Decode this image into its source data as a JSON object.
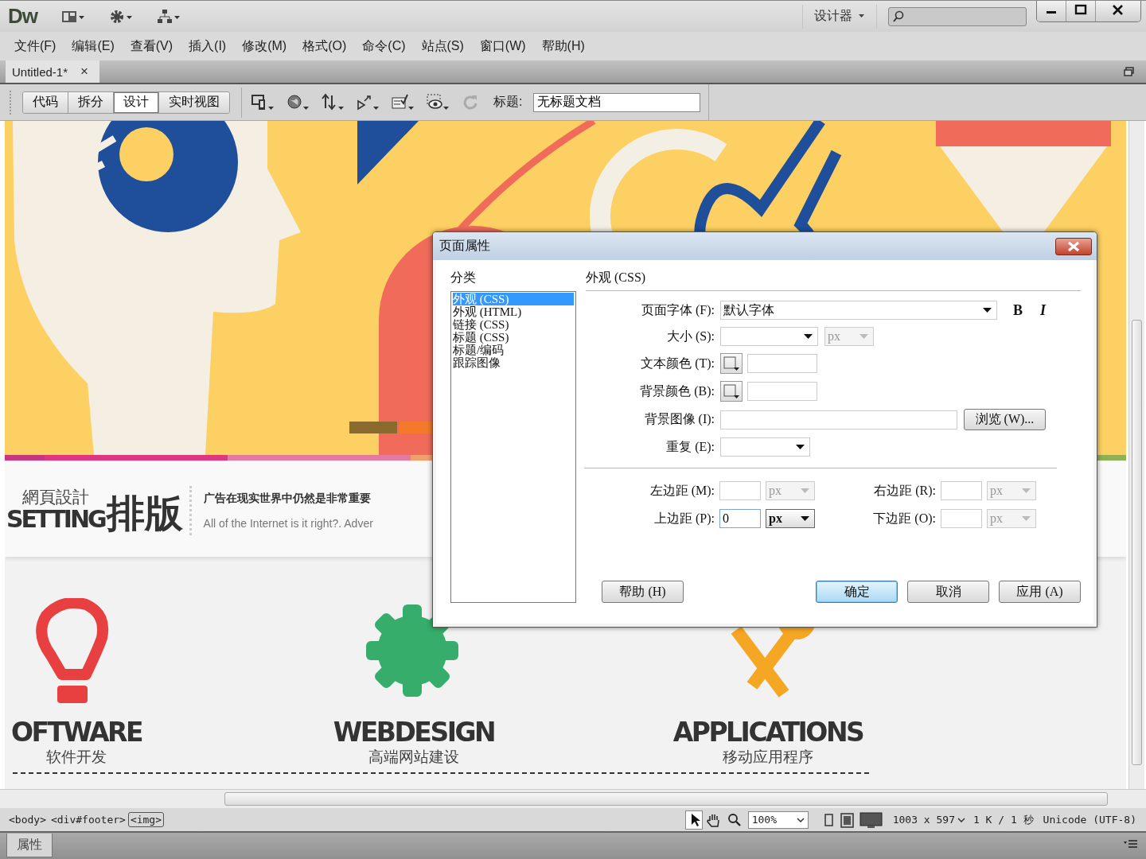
{
  "app_bar": {
    "logo": "Dw",
    "workspace": "设计器"
  },
  "menu": [
    "文件(F)",
    "编辑(E)",
    "查看(V)",
    "插入(I)",
    "修改(M)",
    "格式(O)",
    "命令(C)",
    "站点(S)",
    "窗口(W)",
    "帮助(H)"
  ],
  "document_tabs": [
    {
      "label": "Untitled-1*",
      "selected": true,
      "close": "×"
    }
  ],
  "view_buttons": [
    {
      "label": "代码",
      "selected": false
    },
    {
      "label": "拆分",
      "selected": false
    },
    {
      "label": "设计",
      "selected": true
    },
    {
      "label": "实时视图",
      "selected": false
    }
  ],
  "title_field": {
    "label": "标题:",
    "value": "无标题文档"
  },
  "page": {
    "heading_small": "網頁設計",
    "heading_word": "SETTING",
    "heading_han": "排版",
    "tagline": "广告在现实世界中仍然是非常重要",
    "intro": "All of the Internet is it right?. Adver",
    "services": [
      {
        "kind": "bulb",
        "title": "OFTWARE",
        "subtitle": "软件开发"
      },
      {
        "kind": "gear",
        "title": "WEBDESIGN",
        "subtitle": "高端网站建设"
      },
      {
        "kind": "tools",
        "title": "APPLICATIONS",
        "subtitle": "移动应用程序"
      }
    ]
  },
  "dialog": {
    "title": "页面属性",
    "category_label": "分类",
    "categories": [
      {
        "label": "外观 (CSS)",
        "selected": true
      },
      {
        "label": "外观 (HTML)",
        "selected": false
      },
      {
        "label": "链接 (CSS)",
        "selected": false
      },
      {
        "label": "标题 (CSS)",
        "selected": false
      },
      {
        "label": "标题/编码",
        "selected": false
      },
      {
        "label": "跟踪图像",
        "selected": false
      }
    ],
    "section": "外观 (CSS)",
    "font": {
      "label": "页面字体 (F):",
      "value": "默认字体",
      "bold": "B",
      "italic": "I"
    },
    "size": {
      "label": "大小 (S):",
      "unit": "px",
      "unit_disabled": true
    },
    "text_color": {
      "label": "文本颜色 (T):"
    },
    "background_color": {
      "label": "背景颜色 (B):"
    },
    "background_image": {
      "label": "背景图像 (I):",
      "browse": "浏览 (W)..."
    },
    "repeat": {
      "label": "重复 (E):"
    },
    "margins": [
      {
        "label": "左边距 (M):",
        "unit": "px",
        "disabled": true
      },
      {
        "label": "右边距 (R):",
        "unit": "px",
        "disabled": true
      },
      {
        "label": "上边距 (P):",
        "value": "0",
        "unit": "px",
        "disabled": false
      },
      {
        "label": "下边距 (O):",
        "unit": "px",
        "disabled": true
      }
    ],
    "buttons": [
      {
        "label": "帮助 (H)",
        "default": false
      },
      {
        "label": "确定",
        "default": true
      },
      {
        "label": "取消",
        "default": false
      },
      {
        "label": "应用 (A)",
        "default": false
      }
    ]
  },
  "status_bar": {
    "tags": [
      {
        "label": "<body>",
        "selected": false
      },
      {
        "label": "<div#footer>",
        "selected": false
      },
      {
        "label": "<img>",
        "selected": true
      }
    ],
    "zoom": "100%",
    "dimensions": "1003 x 597",
    "download": "1 K / 1 秒",
    "encoding": "Unicode (UTF-8)"
  },
  "properties_panel": {
    "title": "属性"
  }
}
